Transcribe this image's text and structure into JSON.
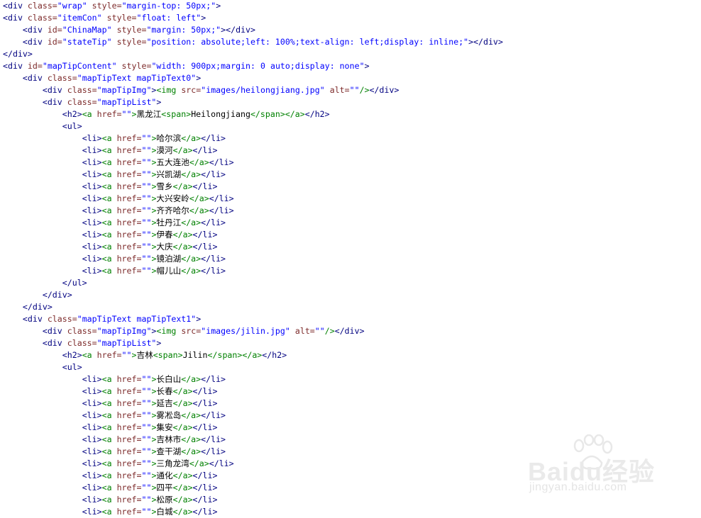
{
  "code_lines": [
    [
      [
        "tb",
        "<div "
      ],
      [
        "an",
        "class="
      ],
      [
        "av",
        "\"wrap\" "
      ],
      [
        "an",
        "style="
      ],
      [
        "av",
        "\"margin-top: 50px;\""
      ],
      [
        "tb",
        ">"
      ]
    ],
    [
      [
        "tb",
        "<div "
      ],
      [
        "an",
        "class="
      ],
      [
        "av",
        "\"itemCon\" "
      ],
      [
        "an",
        "style="
      ],
      [
        "av",
        "\"float: left\""
      ],
      [
        "tb",
        ">"
      ]
    ],
    [
      [
        "tx",
        "    "
      ],
      [
        "tb",
        "<div "
      ],
      [
        "an",
        "id="
      ],
      [
        "av",
        "\"ChinaMap\" "
      ],
      [
        "an",
        "style="
      ],
      [
        "av",
        "\"margin: 50px;\""
      ],
      [
        "tb",
        "></div>"
      ]
    ],
    [
      [
        "tx",
        "    "
      ],
      [
        "tb",
        "<div "
      ],
      [
        "an",
        "id="
      ],
      [
        "av",
        "\"stateTip\" "
      ],
      [
        "an",
        "style="
      ],
      [
        "av",
        "\"position: absolute;left: 100%;text-align: left;display: inline;\""
      ],
      [
        "tb",
        "></div>"
      ]
    ],
    [
      [
        "tb",
        "</div>"
      ]
    ],
    [
      [
        "tb",
        "<div "
      ],
      [
        "an",
        "id="
      ],
      [
        "av",
        "\"mapTipContent\" "
      ],
      [
        "an",
        "style="
      ],
      [
        "av",
        "\"width: 900px;margin: 0 auto;display: none\""
      ],
      [
        "tb",
        ">"
      ]
    ],
    [
      [
        "tx",
        "    "
      ],
      [
        "tb",
        "<div "
      ],
      [
        "an",
        "class="
      ],
      [
        "av",
        "\"mapTipText mapTipText0\""
      ],
      [
        "tb",
        ">"
      ]
    ],
    [
      [
        "tx",
        "        "
      ],
      [
        "tb",
        "<div "
      ],
      [
        "an",
        "class="
      ],
      [
        "av",
        "\"mapTipImg\""
      ],
      [
        "tb",
        ">"
      ],
      [
        "tg",
        "<img "
      ],
      [
        "an",
        "src="
      ],
      [
        "av",
        "\"images/heilongjiang.jpg\" "
      ],
      [
        "an",
        "alt="
      ],
      [
        "av",
        "\"\""
      ],
      [
        "tg",
        "/>"
      ],
      [
        "tb",
        "</div>"
      ]
    ],
    [
      [
        "tx",
        "        "
      ],
      [
        "tb",
        "<div "
      ],
      [
        "an",
        "class="
      ],
      [
        "av",
        "\"mapTipList\""
      ],
      [
        "tb",
        ">"
      ]
    ],
    [
      [
        "tx",
        "            "
      ],
      [
        "tb",
        "<h2>"
      ],
      [
        "tg",
        "<a "
      ],
      [
        "an",
        "href="
      ],
      [
        "av",
        "\"\""
      ],
      [
        "tg",
        ">"
      ],
      [
        "tx",
        "黑龙江"
      ],
      [
        "tg",
        "<span>"
      ],
      [
        "tx",
        "Heilongjiang"
      ],
      [
        "tg",
        "</span></a>"
      ],
      [
        "tb",
        "</h2>"
      ]
    ],
    [
      [
        "tx",
        "            "
      ],
      [
        "tb",
        "<ul>"
      ]
    ],
    [
      [
        "tx",
        "                "
      ],
      [
        "tb",
        "<li>"
      ],
      [
        "tg",
        "<a "
      ],
      [
        "an",
        "href="
      ],
      [
        "av",
        "\"\""
      ],
      [
        "tg",
        ">"
      ],
      [
        "tx",
        "哈尔滨"
      ],
      [
        "tg",
        "</a>"
      ],
      [
        "tb",
        "</li>"
      ]
    ],
    [
      [
        "tx",
        "                "
      ],
      [
        "tb",
        "<li>"
      ],
      [
        "tg",
        "<a "
      ],
      [
        "an",
        "href="
      ],
      [
        "av",
        "\"\""
      ],
      [
        "tg",
        ">"
      ],
      [
        "tx",
        "漠河"
      ],
      [
        "tg",
        "</a>"
      ],
      [
        "tb",
        "</li>"
      ]
    ],
    [
      [
        "tx",
        "                "
      ],
      [
        "tb",
        "<li>"
      ],
      [
        "tg",
        "<a "
      ],
      [
        "an",
        "href="
      ],
      [
        "av",
        "\"\""
      ],
      [
        "tg",
        ">"
      ],
      [
        "tx",
        "五大连池"
      ],
      [
        "tg",
        "</a>"
      ],
      [
        "tb",
        "</li>"
      ]
    ],
    [
      [
        "tx",
        "                "
      ],
      [
        "tb",
        "<li>"
      ],
      [
        "tg",
        "<a "
      ],
      [
        "an",
        "href="
      ],
      [
        "av",
        "\"\""
      ],
      [
        "tg",
        ">"
      ],
      [
        "tx",
        "兴凯湖"
      ],
      [
        "tg",
        "</a>"
      ],
      [
        "tb",
        "</li>"
      ]
    ],
    [
      [
        "tx",
        "                "
      ],
      [
        "tb",
        "<li>"
      ],
      [
        "tg",
        "<a "
      ],
      [
        "an",
        "href="
      ],
      [
        "av",
        "\"\""
      ],
      [
        "tg",
        ">"
      ],
      [
        "tx",
        "雪乡"
      ],
      [
        "tg",
        "</a>"
      ],
      [
        "tb",
        "</li>"
      ]
    ],
    [
      [
        "tx",
        "                "
      ],
      [
        "tb",
        "<li>"
      ],
      [
        "tg",
        "<a "
      ],
      [
        "an",
        "href="
      ],
      [
        "av",
        "\"\""
      ],
      [
        "tg",
        ">"
      ],
      [
        "tx",
        "大兴安岭"
      ],
      [
        "tg",
        "</a>"
      ],
      [
        "tb",
        "</li>"
      ]
    ],
    [
      [
        "tx",
        "                "
      ],
      [
        "tb",
        "<li>"
      ],
      [
        "tg",
        "<a "
      ],
      [
        "an",
        "href="
      ],
      [
        "av",
        "\"\""
      ],
      [
        "tg",
        ">"
      ],
      [
        "tx",
        "齐齐哈尔"
      ],
      [
        "tg",
        "</a>"
      ],
      [
        "tb",
        "</li>"
      ]
    ],
    [
      [
        "tx",
        "                "
      ],
      [
        "tb",
        "<li>"
      ],
      [
        "tg",
        "<a "
      ],
      [
        "an",
        "href="
      ],
      [
        "av",
        "\"\""
      ],
      [
        "tg",
        ">"
      ],
      [
        "tx",
        "牡丹江"
      ],
      [
        "tg",
        "</a>"
      ],
      [
        "tb",
        "</li>"
      ]
    ],
    [
      [
        "tx",
        "                "
      ],
      [
        "tb",
        "<li>"
      ],
      [
        "tg",
        "<a "
      ],
      [
        "an",
        "href="
      ],
      [
        "av",
        "\"\""
      ],
      [
        "tg",
        ">"
      ],
      [
        "tx",
        "伊春"
      ],
      [
        "tg",
        "</a>"
      ],
      [
        "tb",
        "</li>"
      ]
    ],
    [
      [
        "tx",
        "                "
      ],
      [
        "tb",
        "<li>"
      ],
      [
        "tg",
        "<a "
      ],
      [
        "an",
        "href="
      ],
      [
        "av",
        "\"\""
      ],
      [
        "tg",
        ">"
      ],
      [
        "tx",
        "大庆"
      ],
      [
        "tg",
        "</a>"
      ],
      [
        "tb",
        "</li>"
      ]
    ],
    [
      [
        "tx",
        "                "
      ],
      [
        "tb",
        "<li>"
      ],
      [
        "tg",
        "<a "
      ],
      [
        "an",
        "href="
      ],
      [
        "av",
        "\"\""
      ],
      [
        "tg",
        ">"
      ],
      [
        "tx",
        "镜泊湖"
      ],
      [
        "tg",
        "</a>"
      ],
      [
        "tb",
        "</li>"
      ]
    ],
    [
      [
        "tx",
        "                "
      ],
      [
        "tb",
        "<li>"
      ],
      [
        "tg",
        "<a "
      ],
      [
        "an",
        "href="
      ],
      [
        "av",
        "\"\""
      ],
      [
        "tg",
        ">"
      ],
      [
        "tx",
        "帽儿山"
      ],
      [
        "tg",
        "</a>"
      ],
      [
        "tb",
        "</li>"
      ]
    ],
    [
      [
        "tx",
        "            "
      ],
      [
        "tb",
        "</ul>"
      ]
    ],
    [
      [
        "tx",
        "        "
      ],
      [
        "tb",
        "</div>"
      ]
    ],
    [
      [
        "tx",
        "    "
      ],
      [
        "tb",
        "</div>"
      ]
    ],
    [
      [
        "tx",
        "    "
      ],
      [
        "tb",
        "<div "
      ],
      [
        "an",
        "class="
      ],
      [
        "av",
        "\"mapTipText mapTipText1\""
      ],
      [
        "tb",
        ">"
      ]
    ],
    [
      [
        "tx",
        "        "
      ],
      [
        "tb",
        "<div "
      ],
      [
        "an",
        "class="
      ],
      [
        "av",
        "\"mapTipImg\""
      ],
      [
        "tb",
        ">"
      ],
      [
        "tg",
        "<img "
      ],
      [
        "an",
        "src="
      ],
      [
        "av",
        "\"images/jilin.jpg\" "
      ],
      [
        "an",
        "alt="
      ],
      [
        "av",
        "\"\""
      ],
      [
        "tg",
        "/>"
      ],
      [
        "tb",
        "</div>"
      ]
    ],
    [
      [
        "tx",
        "        "
      ],
      [
        "tb",
        "<div "
      ],
      [
        "an",
        "class="
      ],
      [
        "av",
        "\"mapTipList\""
      ],
      [
        "tb",
        ">"
      ]
    ],
    [
      [
        "tx",
        "            "
      ],
      [
        "tb",
        "<h2>"
      ],
      [
        "tg",
        "<a "
      ],
      [
        "an",
        "href="
      ],
      [
        "av",
        "\"\""
      ],
      [
        "tg",
        ">"
      ],
      [
        "tx",
        "吉林"
      ],
      [
        "tg",
        "<span>"
      ],
      [
        "tx",
        "Jilin"
      ],
      [
        "tg",
        "</span></a>"
      ],
      [
        "tb",
        "</h2>"
      ]
    ],
    [
      [
        "tx",
        "            "
      ],
      [
        "tb",
        "<ul>"
      ]
    ],
    [
      [
        "tx",
        "                "
      ],
      [
        "tb",
        "<li>"
      ],
      [
        "tg",
        "<a "
      ],
      [
        "an",
        "href="
      ],
      [
        "av",
        "\"\""
      ],
      [
        "tg",
        ">"
      ],
      [
        "tx",
        "长白山"
      ],
      [
        "tg",
        "</a>"
      ],
      [
        "tb",
        "</li>"
      ]
    ],
    [
      [
        "tx",
        "                "
      ],
      [
        "tb",
        "<li>"
      ],
      [
        "tg",
        "<a "
      ],
      [
        "an",
        "href="
      ],
      [
        "av",
        "\"\""
      ],
      [
        "tg",
        ">"
      ],
      [
        "tx",
        "长春"
      ],
      [
        "tg",
        "</a>"
      ],
      [
        "tb",
        "</li>"
      ]
    ],
    [
      [
        "tx",
        "                "
      ],
      [
        "tb",
        "<li>"
      ],
      [
        "tg",
        "<a "
      ],
      [
        "an",
        "href="
      ],
      [
        "av",
        "\"\""
      ],
      [
        "tg",
        ">"
      ],
      [
        "tx",
        "延吉"
      ],
      [
        "tg",
        "</a>"
      ],
      [
        "tb",
        "</li>"
      ]
    ],
    [
      [
        "tx",
        "                "
      ],
      [
        "tb",
        "<li>"
      ],
      [
        "tg",
        "<a "
      ],
      [
        "an",
        "href="
      ],
      [
        "av",
        "\"\""
      ],
      [
        "tg",
        ">"
      ],
      [
        "tx",
        "雾凇岛"
      ],
      [
        "tg",
        "</a>"
      ],
      [
        "tb",
        "</li>"
      ]
    ],
    [
      [
        "tx",
        "                "
      ],
      [
        "tb",
        "<li>"
      ],
      [
        "tg",
        "<a "
      ],
      [
        "an",
        "href="
      ],
      [
        "av",
        "\"\""
      ],
      [
        "tg",
        ">"
      ],
      [
        "tx",
        "集安"
      ],
      [
        "tg",
        "</a>"
      ],
      [
        "tb",
        "</li>"
      ]
    ],
    [
      [
        "tx",
        "                "
      ],
      [
        "tb",
        "<li>"
      ],
      [
        "tg",
        "<a "
      ],
      [
        "an",
        "href="
      ],
      [
        "av",
        "\"\""
      ],
      [
        "tg",
        ">"
      ],
      [
        "tx",
        "吉林市"
      ],
      [
        "tg",
        "</a>"
      ],
      [
        "tb",
        "</li>"
      ]
    ],
    [
      [
        "tx",
        "                "
      ],
      [
        "tb",
        "<li>"
      ],
      [
        "tg",
        "<a "
      ],
      [
        "an",
        "href="
      ],
      [
        "av",
        "\"\""
      ],
      [
        "tg",
        ">"
      ],
      [
        "tx",
        "查干湖"
      ],
      [
        "tg",
        "</a>"
      ],
      [
        "tb",
        "</li>"
      ]
    ],
    [
      [
        "tx",
        "                "
      ],
      [
        "tb",
        "<li>"
      ],
      [
        "tg",
        "<a "
      ],
      [
        "an",
        "href="
      ],
      [
        "av",
        "\"\""
      ],
      [
        "tg",
        ">"
      ],
      [
        "tx",
        "三角龙湾"
      ],
      [
        "tg",
        "</a>"
      ],
      [
        "tb",
        "</li>"
      ]
    ],
    [
      [
        "tx",
        "                "
      ],
      [
        "tb",
        "<li>"
      ],
      [
        "tg",
        "<a "
      ],
      [
        "an",
        "href="
      ],
      [
        "av",
        "\"\""
      ],
      [
        "tg",
        ">"
      ],
      [
        "tx",
        "通化"
      ],
      [
        "tg",
        "</a>"
      ],
      [
        "tb",
        "</li>"
      ]
    ],
    [
      [
        "tx",
        "                "
      ],
      [
        "tb",
        "<li>"
      ],
      [
        "tg",
        "<a "
      ],
      [
        "an",
        "href="
      ],
      [
        "av",
        "\"\""
      ],
      [
        "tg",
        ">"
      ],
      [
        "tx",
        "四平"
      ],
      [
        "tg",
        "</a>"
      ],
      [
        "tb",
        "</li>"
      ]
    ],
    [
      [
        "tx",
        "                "
      ],
      [
        "tb",
        "<li>"
      ],
      [
        "tg",
        "<a "
      ],
      [
        "an",
        "href="
      ],
      [
        "av",
        "\"\""
      ],
      [
        "tg",
        ">"
      ],
      [
        "tx",
        "松原"
      ],
      [
        "tg",
        "</a>"
      ],
      [
        "tb",
        "</li>"
      ]
    ],
    [
      [
        "tx",
        "                "
      ],
      [
        "tb",
        "<li>"
      ],
      [
        "tg",
        "<a "
      ],
      [
        "an",
        "href="
      ],
      [
        "av",
        "\"\""
      ],
      [
        "tg",
        ">"
      ],
      [
        "tx",
        "白城"
      ],
      [
        "tg",
        "</a>"
      ],
      [
        "tb",
        "</li>"
      ]
    ]
  ],
  "colors": {
    "tb": "#000080",
    "an": "#7d2b2b",
    "av": "#0000ff",
    "tx": "#000000",
    "tg": "#008000",
    "background": "#ffffff"
  },
  "watermark": {
    "brand": "Baidu经验",
    "url": "jingyan.baidu.com",
    "icon": "paw-icon"
  }
}
